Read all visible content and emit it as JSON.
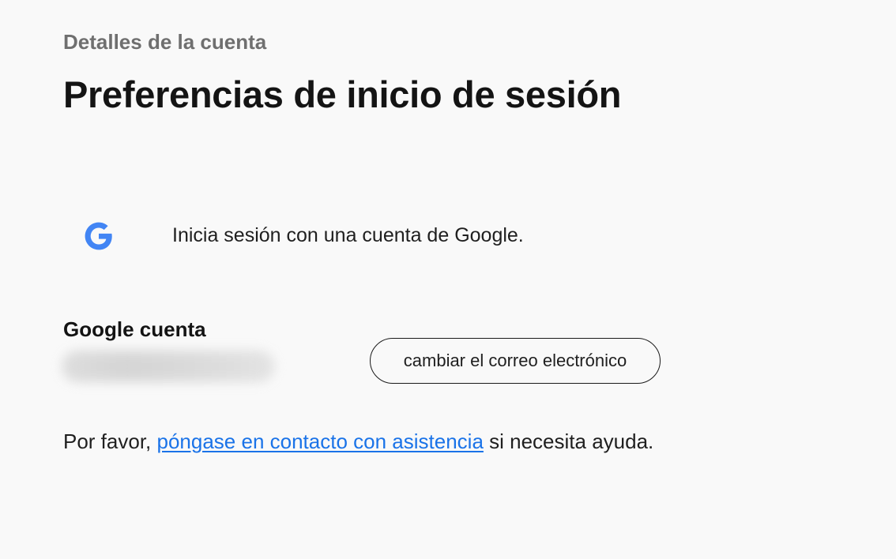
{
  "header": {
    "breadcrumb": "Detalles de la cuenta",
    "title": "Preferencias de inicio de sesión"
  },
  "google_signin": {
    "icon": "google-icon",
    "text": "Inicia sesión con una cuenta de Google."
  },
  "account": {
    "label": "Google cuenta",
    "email_blurred": true,
    "change_email_label": "cambiar el correo electrónico"
  },
  "help": {
    "prefix": "Por favor, ",
    "link_text": "póngase en contacto con asistencia",
    "suffix": " si necesita ayuda."
  },
  "colors": {
    "background": "#f9f9f9",
    "link": "#1a73e8",
    "google_blue": "#4285F4",
    "breadcrumb": "#6f6f6f",
    "text": "#1a1a1a"
  }
}
